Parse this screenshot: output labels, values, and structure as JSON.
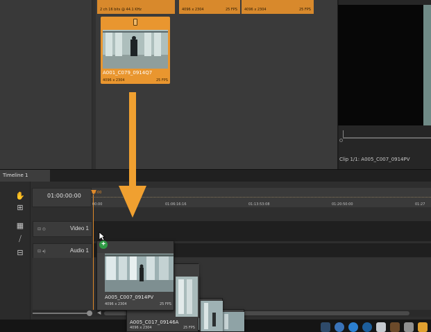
{
  "browser": {
    "strip_a_text": "2 ch 16 bits @ 44.1 KHz",
    "strip_b_res": "4096 x 2304",
    "strip_b_fps": "25 FPS",
    "strip_c_res": "4096 x 2304",
    "strip_c_fps": "25 FPS",
    "clip": {
      "name": "A001_C079_0914Q7",
      "resolution": "4096 x 2304",
      "fps": "25 FPS"
    }
  },
  "viewer": {
    "caption": "Clip 1/1: A005_C007_0914PV"
  },
  "timeline": {
    "tab_label": "Timeline 1",
    "timecode": "01:00:00:00",
    "ruler_labels": [
      "00:00",
      "01:06:16:16",
      "01:13:53:08",
      "01:20:50:00",
      "01:27"
    ],
    "playhead_label": "00:00",
    "tracks": [
      {
        "label": "Video 1",
        "icons": "⊟ ◎"
      },
      {
        "label": "Audio 1",
        "icons": "⊟ ◂)"
      }
    ],
    "tools": [
      "hand-tool",
      "ripple-tool",
      "slip-tool",
      "razor-tool",
      "zoom-tool"
    ]
  },
  "drag": {
    "main": {
      "name": "A005_C007_0914PV",
      "resolution": "4096 x 2304",
      "fps": "25 FPS"
    },
    "second": {
      "name": "A005_C017_09146A",
      "resolution": "4096 x 2304",
      "fps": "25 FPS"
    },
    "add_symbol": "+"
  },
  "colors": {
    "accent": "#e08a2a",
    "arrow": "#f0a030",
    "add_badge": "#2f9a45"
  }
}
